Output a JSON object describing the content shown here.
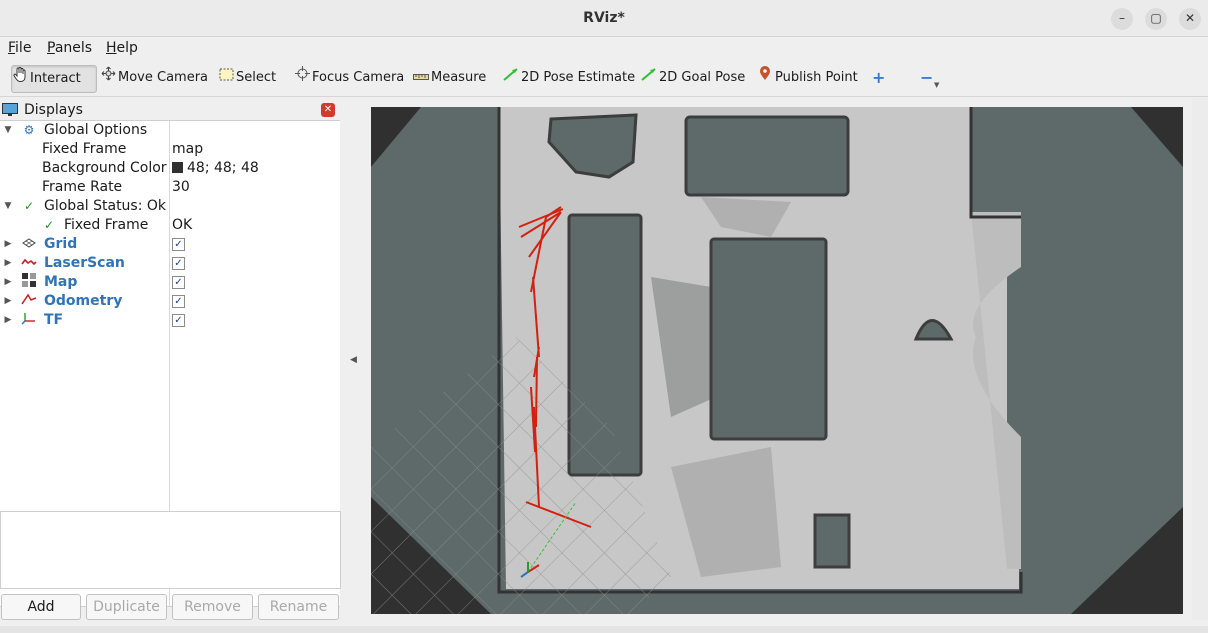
{
  "window": {
    "title": "RViz*",
    "minimize": "–",
    "maximize": "▢",
    "close": "✕"
  },
  "menu": [
    {
      "mnemonic": "F",
      "rest": "ile"
    },
    {
      "mnemonic": "P",
      "rest": "anels"
    },
    {
      "mnemonic": "H",
      "rest": "elp"
    }
  ],
  "toolbar": {
    "interact": "Interact",
    "move_camera": "Move Camera",
    "select": "Select",
    "focus_camera": "Focus Camera",
    "measure": "Measure",
    "pose_estimate": "2D Pose Estimate",
    "goal_pose": "2D Goal Pose",
    "publish_point": "Publish Point",
    "add_tool": "+",
    "remove_tool": "−"
  },
  "displays": {
    "header": "Displays",
    "global_options": {
      "label": "Global Options"
    },
    "fixed_frame": {
      "label": "Fixed Frame",
      "value": "map"
    },
    "background_color": {
      "label": "Background Color",
      "value": "48; 48; 48",
      "color": "#303030"
    },
    "frame_rate": {
      "label": "Frame Rate",
      "value": "30"
    },
    "global_status": {
      "label": "Global Status: Ok"
    },
    "status_fixed_frame": {
      "label": "Fixed Frame",
      "value": "OK"
    },
    "plugins": [
      {
        "label": "Grid",
        "enabled": true,
        "icon": "grid-icon"
      },
      {
        "label": "LaserScan",
        "enabled": true,
        "icon": "laserscan-icon"
      },
      {
        "label": "Map",
        "enabled": true,
        "icon": "map-icon"
      },
      {
        "label": "Odometry",
        "enabled": true,
        "icon": "odometry-icon"
      },
      {
        "label": "TF",
        "enabled": true,
        "icon": "tf-icon"
      }
    ],
    "check_mark": "✓"
  },
  "buttons": {
    "add": "Add",
    "duplicate": "Duplicate",
    "remove": "Remove",
    "rename": "Rename"
  },
  "colors": {
    "accent_blue": "#2f74b8",
    "odom_red": "#d4200f",
    "map_free": "#c6c6c6",
    "map_unknown": "#5d6a69",
    "viewport_bg": "#303030"
  }
}
